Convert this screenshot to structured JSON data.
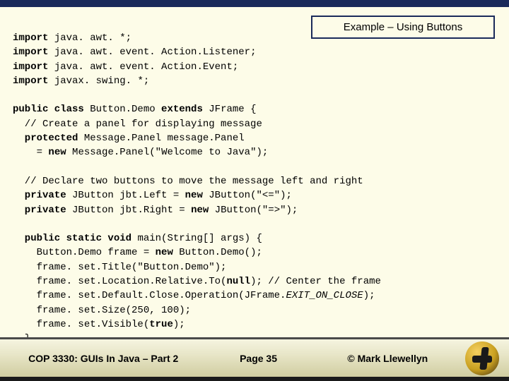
{
  "title": "Example – Using Buttons",
  "code": {
    "l1a": "import",
    "l1b": " java. awt. *;",
    "l2a": "import",
    "l2b": " java. awt. event. Action.Listener;",
    "l3a": "import",
    "l3b": " java. awt. event. Action.Event;",
    "l4a": "import",
    "l4b": " javax. swing. *;",
    "l6a": "public class ",
    "l6b": "Button.Demo ",
    "l6c": "extends",
    "l6d": " JFrame {",
    "l7": "  // Create a panel for displaying message",
    "l8a": "  protected",
    "l8b": " Message.Panel message.Panel",
    "l9a": "    = ",
    "l9b": "new",
    "l9c": " Message.Panel(\"Welcome to Java\");",
    "l11": "  // Declare two buttons to move the message left and right",
    "l12a": "  private",
    "l12b": " JButton jbt.Left = ",
    "l12c": "new",
    "l12d": " JButton(\"<=\");",
    "l13a": "  private",
    "l13b": " JButton jbt.Right = ",
    "l13c": "new",
    "l13d": " JButton(\"=>\");",
    "l15a": "  public static void ",
    "l15b": "main(String[] args) {",
    "l16a": "    Button.Demo frame = ",
    "l16b": "new",
    "l16c": " Button.Demo();",
    "l17": "    frame. set.Title(\"Button.Demo\");",
    "l18a": "    frame. set.Location.Relative.To(",
    "l18b": "null",
    "l18c": "); // Center the frame",
    "l19a": "    frame. set.Default.Close.Operation(JFrame.",
    "l19b": "EXIT_ON_CLOSE",
    "l19c": ");",
    "l20": "    frame. set.Size(250, 100);",
    "l21a": "    frame. set.Visible(",
    "l21b": "true",
    "l21c": ");",
    "l22": "  }"
  },
  "footer": {
    "course": "COP 3330:  GUIs In Java – Part 2",
    "page": "Page 35",
    "author": "© Mark Llewellyn"
  }
}
